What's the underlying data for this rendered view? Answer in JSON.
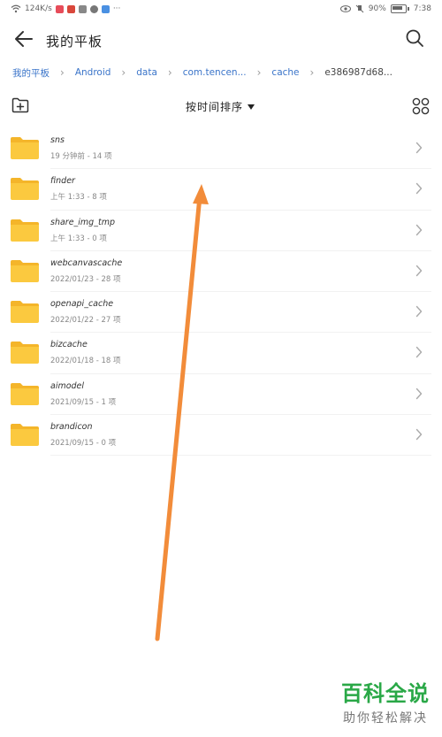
{
  "statusbar": {
    "speed": "124K/s",
    "battery": "90%",
    "time": "7:38"
  },
  "header": {
    "title": "我的平板"
  },
  "breadcrumb": [
    {
      "label": "我的平板"
    },
    {
      "label": "Android"
    },
    {
      "label": "data"
    },
    {
      "label": "com.tencen..."
    },
    {
      "label": "cache"
    },
    {
      "label": "e386987d68..."
    }
  ],
  "toolbar": {
    "sort_label": "按时间排序"
  },
  "files": [
    {
      "name": "sns",
      "meta": "19 分钟前 - 14 项"
    },
    {
      "name": "finder",
      "meta": "上午 1:33 - 8 项"
    },
    {
      "name": "share_img_tmp",
      "meta": "上午 1:33 - 0 项"
    },
    {
      "name": "webcanvascache",
      "meta": "2022/01/23 - 28 项"
    },
    {
      "name": "openapi_cache",
      "meta": "2022/01/22 - 27 项"
    },
    {
      "name": "bizcache",
      "meta": "2022/01/18 - 18 项"
    },
    {
      "name": "aimodel",
      "meta": "2021/09/15 - 1 项"
    },
    {
      "name": "brandicon",
      "meta": "2021/09/15 - 0 项"
    }
  ],
  "watermark": {
    "main": "百科全说",
    "sub": "助你轻松解决"
  },
  "colors": {
    "folder": "#fbc93f",
    "folder_tab": "#f4b52a",
    "breadcrumb_link": "#3a74c9",
    "annotation_arrow": "#f28c3a",
    "watermark_green": "#2aa847"
  }
}
